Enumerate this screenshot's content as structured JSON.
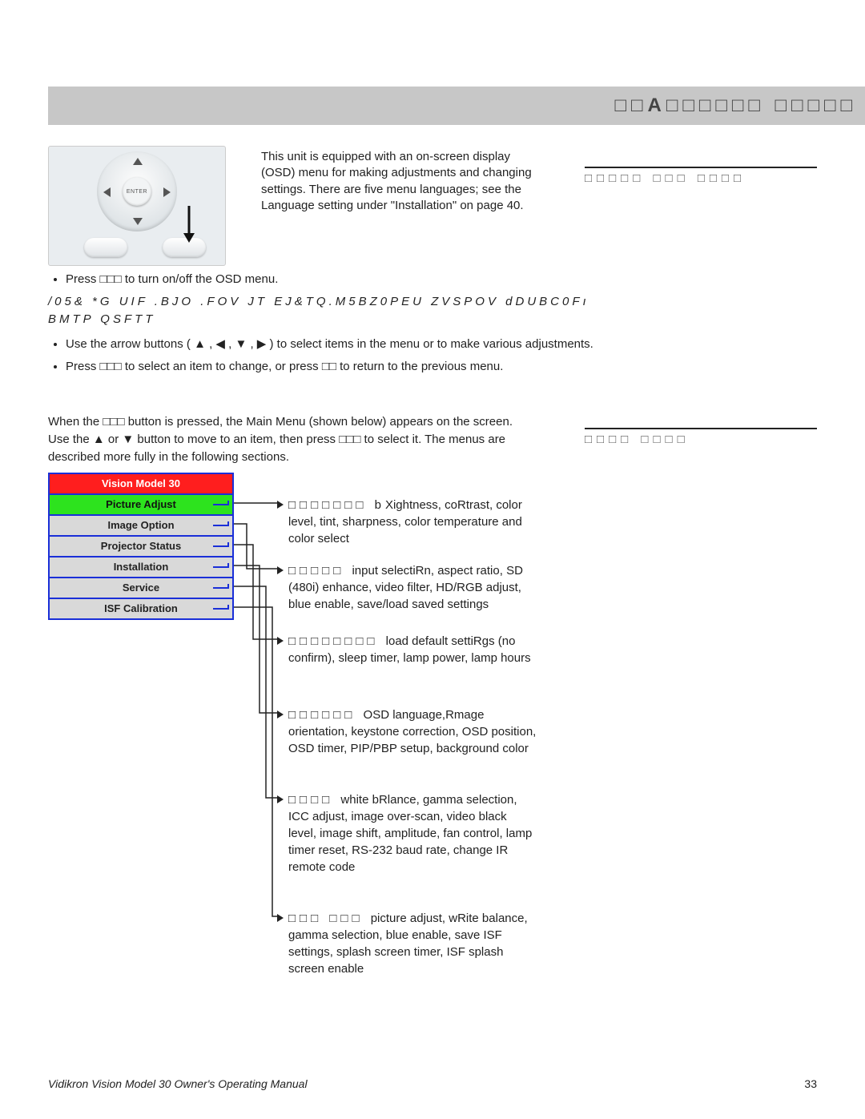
{
  "header": "□□A□□□□□□ □□□□□",
  "remote": {
    "center": "ENTER"
  },
  "intro": "This unit is equipped with an on-screen display (OSD) menu for making adjustments and changing settings. There are five menu languages; see the Language setting under \"Installation\" on page 40.",
  "side_labels": {
    "l1": "□□□□□ □□□ □□□□",
    "l2": "□□□□ □□□□"
  },
  "bullets": {
    "b1a": "Press ",
    "b1b": "□□□",
    "b1c": " to turn on/off the OSD menu.",
    "note": "/05&   *G  UIF  .BJO  .FOV  JT  EJ&TQ.M5BZ0PEU  ZVSPOV  dDUBC0Fı BMTP  QSFTT",
    "b2": "Use the arrow buttons ( ▲ , ◀ , ▼ , ▶ ) to select items in the menu or to make various adjustments.",
    "b3": "Press □□□ to select an item to change, or press □□ to return to the previous menu."
  },
  "mainpara": "When the □□□ button is pressed, the Main Menu (shown below) appears on the screen. Use the ▲ or ▼ button to move to an item, then press □□□ to select it. The menus are described more fully in the following sections.",
  "menu": {
    "title": "Vision Model 30",
    "items": [
      "Picture Adjust",
      "Image Option",
      "Projector Status",
      "Installation",
      "Service",
      "ISF Calibration"
    ]
  },
  "desc": {
    "d0": {
      "lead": "□□□□□□□ b",
      "rest": "Xightness, coRtrast, color level, tint, sharpness, color temperature and color select"
    },
    "d1": {
      "lead": "□□□□□ ",
      "rest": "input selectiRn, aspect ratio, SD (480i) enhance, video filter, HD/RGB adjust, blue enable, save/load saved settings"
    },
    "d2": {
      "lead": "□□□□□□□□ ",
      "rest": "load default settiRgs (no confirm), sleep timer, lamp power, lamp hours"
    },
    "d3": {
      "lead": "□□□□□□ ",
      "rest": "OSD language,Rmage orientation, keystone correction, OSD position, OSD timer, PIP/PBP setup, background color"
    },
    "d4": {
      "lead": "□□□□ ",
      "rest": "white bRlance, gamma selection, ICC adjust, image over-scan, video black level, image shift, amplitude, fan control, lamp timer reset, RS-232 baud rate, change IR remote code"
    },
    "d5": {
      "lead": "□□□ □□□ ",
      "rest": "picture adjust, wRite balance, gamma selection, blue enable, save ISF settings, splash screen timer, ISF splash screen enable"
    }
  },
  "footer": {
    "title": "Vidikron Vision Model 30 Owner's Operating Manual",
    "page": "33"
  }
}
